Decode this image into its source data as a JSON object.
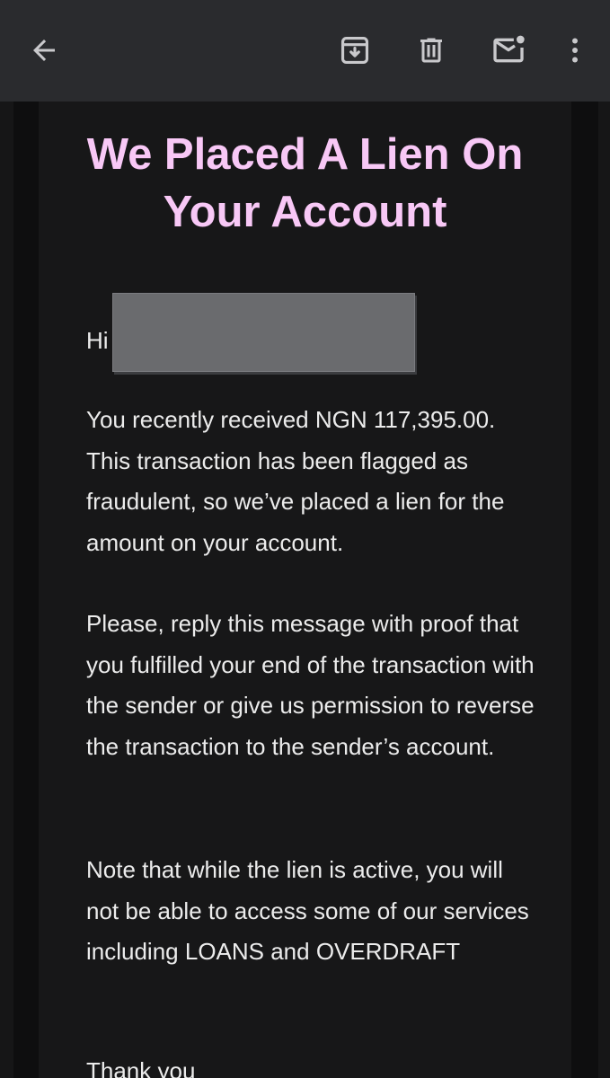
{
  "toolbar": {
    "back_icon": "arrow-left-icon",
    "archive_icon": "archive-icon",
    "delete_icon": "trash-icon",
    "unread_icon": "mark-unread-icon",
    "more_icon": "more-vert-icon"
  },
  "email": {
    "headline_line1": "We Placed A Lien On",
    "headline_line2": "Your Account",
    "greeting": "Hi",
    "paragraphs": [
      "You recently received NGN 117,395.00. This transaction has been flagged as fraudulent, so we’ve placed a lien for the amount on your account.",
      "Please, reply this message with proof that you fulfilled your end of the transaction with the sender or give us permission to reverse the transaction to the sender’s account.",
      "Note that while the lien is active, you will not be able to access some of our services including LOANS and OVERDRAFT",
      "Thank you"
    ]
  },
  "colors": {
    "headline": "#f8c8f6",
    "toolbar_bg": "#2a2b2e",
    "body_bg": "#171718",
    "text": "#ececec"
  }
}
